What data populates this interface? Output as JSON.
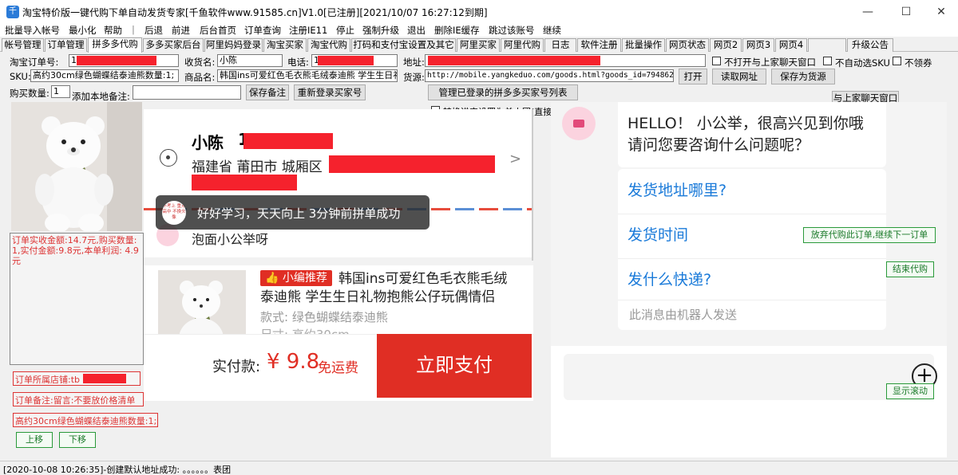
{
  "window": {
    "title": "淘宝特价版一键代购下单自动发货专家[千鱼软件www.91585.cn]V1.0[已注册][2021/10/07 16:27:12到期]",
    "app_icon": "千",
    "minimize": "—",
    "maximize": "☐",
    "close": "✕"
  },
  "menu": [
    "批量导入帐号",
    "最小化",
    "帮助",
    "|",
    "后退",
    "前进",
    "后台首页",
    "订单查询",
    "注册IE11",
    "停止",
    "强制升级",
    "退出",
    "删除IE缓存",
    "跳过该账号",
    "继续"
  ],
  "tabs": [
    "帐号管理",
    "订单管理",
    "拼多多代购",
    "多多买家后台",
    "阿里妈妈登录",
    "淘宝买家",
    "淘宝代购",
    "打码和支付宝设置及其它",
    "阿里买家",
    "阿里代购",
    "日志",
    "软件注册",
    "批量操作",
    "网页状态",
    "网页2",
    "网页3",
    "网页4",
    "",
    "升级公告"
  ],
  "active_tab": "拼多多代购",
  "form": {
    "order_no_label": "淘宝订单号:",
    "order_no_prefix": "1",
    "receiver_label": "收货名:",
    "receiver_value": "小陈",
    "phone_label": "电话:",
    "phone_prefix": "1",
    "address_label": "地址:",
    "no_open_chat": "不打开与上家聊天窗口",
    "no_auto_sku": "不自动选SKU",
    "no_coupon": "不领券",
    "sku_label": "SKU:",
    "sku_value": "高约30cm绿色蝴蝶结泰迪熊数量:1;",
    "product_label": "商品名:",
    "product_value": "韩国ins可爱红色毛衣熊毛绒泰迪熊 学生生日礼",
    "source_label": "货源:",
    "source_value": "http://mobile.yangkeduo.com/goods.html?goods_id=79486241",
    "open_btn": "打开",
    "read_url_btn": "读取网址",
    "save_source_btn": "保存为货源",
    "qty_label": "购买数量:",
    "qty_value": "1",
    "remark_label": "添加本地备注:",
    "save_remark_btn": "保存备注",
    "relogin_btn": "重新登录买家号",
    "manage_buyers_btn": "管理已登录的拼多多买家号列表",
    "convert_single": "转换进宝设置为单人团(直接成团,但是小部分商品会变成单买价)",
    "chat_seller_btn": "与上家聊天窗口"
  },
  "left_info": {
    "amount_text": "订单实收金额:14.7元,购买数量:1,实付金额:9.8元,本单利润: 4.9元",
    "shop_text": "订单所属店铺:tb",
    "remark_text": "订单备注:留言:不要放价格清单",
    "sku_text": "高约30cm绿色蝴蝶结泰迪熊数量:1;",
    "up_btn": "上移",
    "down_btn": "下移"
  },
  "order_page": {
    "name": "小陈",
    "phone_prefix": "1",
    "address": "福建省 莆田市 城厢区",
    "toast": "好好学习，天天向上 3分钟前拼单成功",
    "toast_avatar": "不考上 重点高中 不换头像",
    "shop_name": "泡面小公举呀",
    "badge": "小编推荐",
    "product_title": "韩国ins可爱红色毛衣熊毛绒泰迪熊 学生生日礼物抱熊公仔玩偶情侣",
    "style_label": "款式: 绿色蝴蝶结泰迪熊",
    "size_label": "尺寸: 高约30cm",
    "pay_label": "实付款:",
    "pay_amount": "¥ 9.8",
    "free_ship": "免运费",
    "pay_button": "立即支付"
  },
  "chat": {
    "greeting": "HELLO！ 小公举，很高兴见到你哦 请问您要咨询什么问题呢？",
    "q1": "发货地址哪里?",
    "q2": "发货时间",
    "q3": "发什么快递?",
    "footer": "此消息由机器人发送",
    "abandon_btn": "放弃代购此订单,继续下一订单",
    "finish_btn": "结束代购",
    "scroll_btn": "显示滚动",
    "plus_icon": "+"
  },
  "status": "[2020-10-08 10:26:35]-创建默认地址成功: 。。。。。。表团",
  "colors": {
    "redact": "#f5222d",
    "pay_red": "#e02e24",
    "link_blue": "#1a7ad9"
  }
}
